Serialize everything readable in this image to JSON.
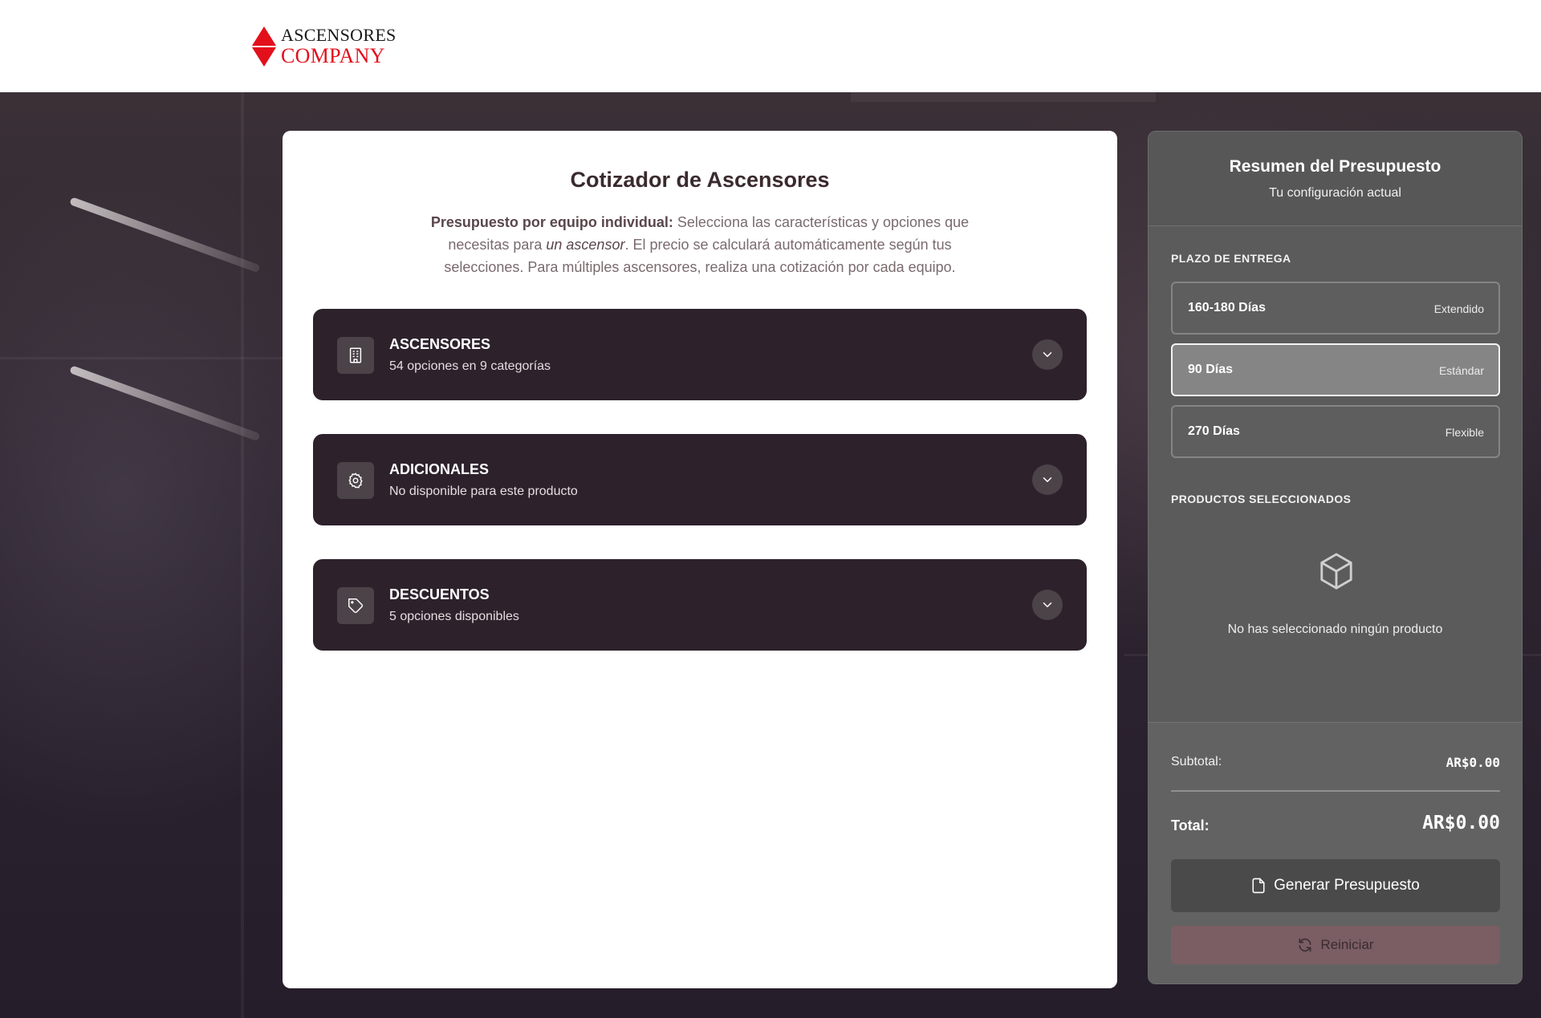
{
  "brand": {
    "line1": "ASCENSORES",
    "line2": "COMPANY",
    "logo_color": "#e3101c"
  },
  "main": {
    "title": "Cotizador de Ascensores",
    "intro": {
      "bold": "Presupuesto por equipo individual:",
      "part1": " Selecciona las características y opciones que necesitas para ",
      "italic": "un ascensor",
      "part2": ". El precio se calculará automáticamente según tus selecciones. Para múltiples ascensores, realiza una cotización por cada equipo."
    },
    "sections": [
      {
        "name": "ASCENSORES",
        "subtitle": "54 opciones en 9 categorías",
        "icon": "building-icon"
      },
      {
        "name": "ADICIONALES",
        "subtitle": "No disponible para este producto",
        "icon": "gear-icon"
      },
      {
        "name": "DESCUENTOS",
        "subtitle": "5 opciones disponibles",
        "icon": "tag-icon"
      }
    ]
  },
  "summary": {
    "title": "Resumen del Presupuesto",
    "subtitle": "Tu configuración actual",
    "delivery_label": "PLAZO DE ENTREGA",
    "delivery_options": [
      {
        "name": "160-180 Días",
        "tag": "Extendido",
        "selected": false
      },
      {
        "name": "90 Días",
        "tag": "Estándar",
        "selected": true
      },
      {
        "name": "270 Días",
        "tag": "Flexible",
        "selected": false
      }
    ],
    "products_label": "PRODUCTOS SELECCIONADOS",
    "empty_icon": "box-icon",
    "empty_text": "No has seleccionado ningún producto",
    "subtotal_label": "Subtotal:",
    "subtotal_value": "AR$0.00",
    "total_label": "Total:",
    "total_value": "AR$0.00",
    "generate_label": "Generar Presupuesto",
    "generate_icon": "document-icon",
    "reset_label": "Reiniciar",
    "reset_icon": "refresh-icon"
  }
}
